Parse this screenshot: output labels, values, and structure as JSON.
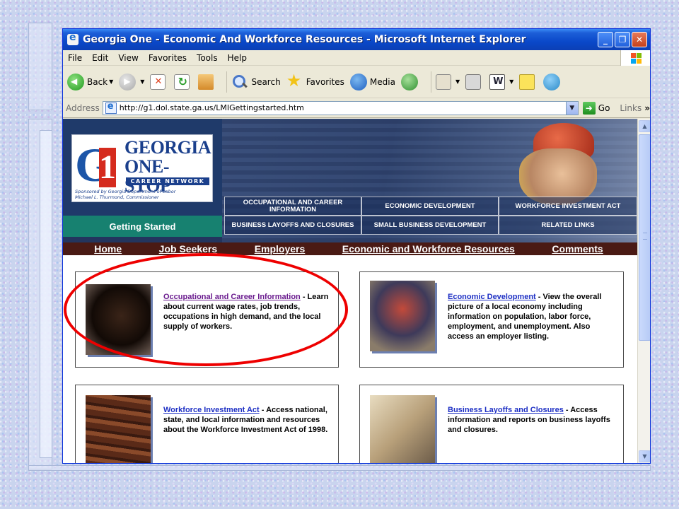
{
  "window": {
    "title": "Georgia One - Economic And Workforce Resources - Microsoft Internet Explorer",
    "controls": [
      "_",
      "❐",
      "✕"
    ]
  },
  "menu": [
    "File",
    "Edit",
    "View",
    "Favorites",
    "Tools",
    "Help"
  ],
  "toolbar": {
    "back": "Back",
    "search": "Search",
    "favorites": "Favorites",
    "media": "Media"
  },
  "address": {
    "label": "Address",
    "url": "http://g1.dol.state.ga.us/LMIGettingstarted.htm",
    "go": "Go",
    "links": "Links",
    "more": "»"
  },
  "header": {
    "logo_line1": "GEORGIA",
    "logo_line2": "ONE-STOP",
    "logo_career": "CAREER NETWORK",
    "sponsor_line1": "Sponsored by Georgia Department of Labor",
    "sponsor_line2": "Michael L. Thurmond, Commissioner",
    "getting_started": "Getting Started",
    "nav_cells": [
      "OCCUPATIONAL AND CAREER INFORMATION",
      "ECONOMIC DEVELOPMENT",
      "WORKFORCE INVESTMENT ACT",
      "BUSINESS LAYOFFS AND CLOSURES",
      "SMALL BUSINESS DEVELOPMENT",
      "RELATED LINKS"
    ]
  },
  "topnav": [
    "Home",
    "Job Seekers",
    "Employers",
    "Economic and Workforce Resources",
    "Comments"
  ],
  "cards": [
    {
      "link": "Occupational and Career Information",
      "text": " - Learn about current wage rates, job trends, occupations in high demand, and the local supply of workers."
    },
    {
      "link": "Economic Development",
      "text": " - View the overall picture of a local economy including information on population, labor force, employment, and unemployment. Also access an employer listing."
    },
    {
      "link": "Workforce Investment Act",
      "text": " - Access national, state, and local information and resources about the Workforce Investment Act of 1998."
    },
    {
      "link": "Business Layoffs and Closures",
      "text": " - Access information and reports on business layoffs and closures."
    }
  ]
}
